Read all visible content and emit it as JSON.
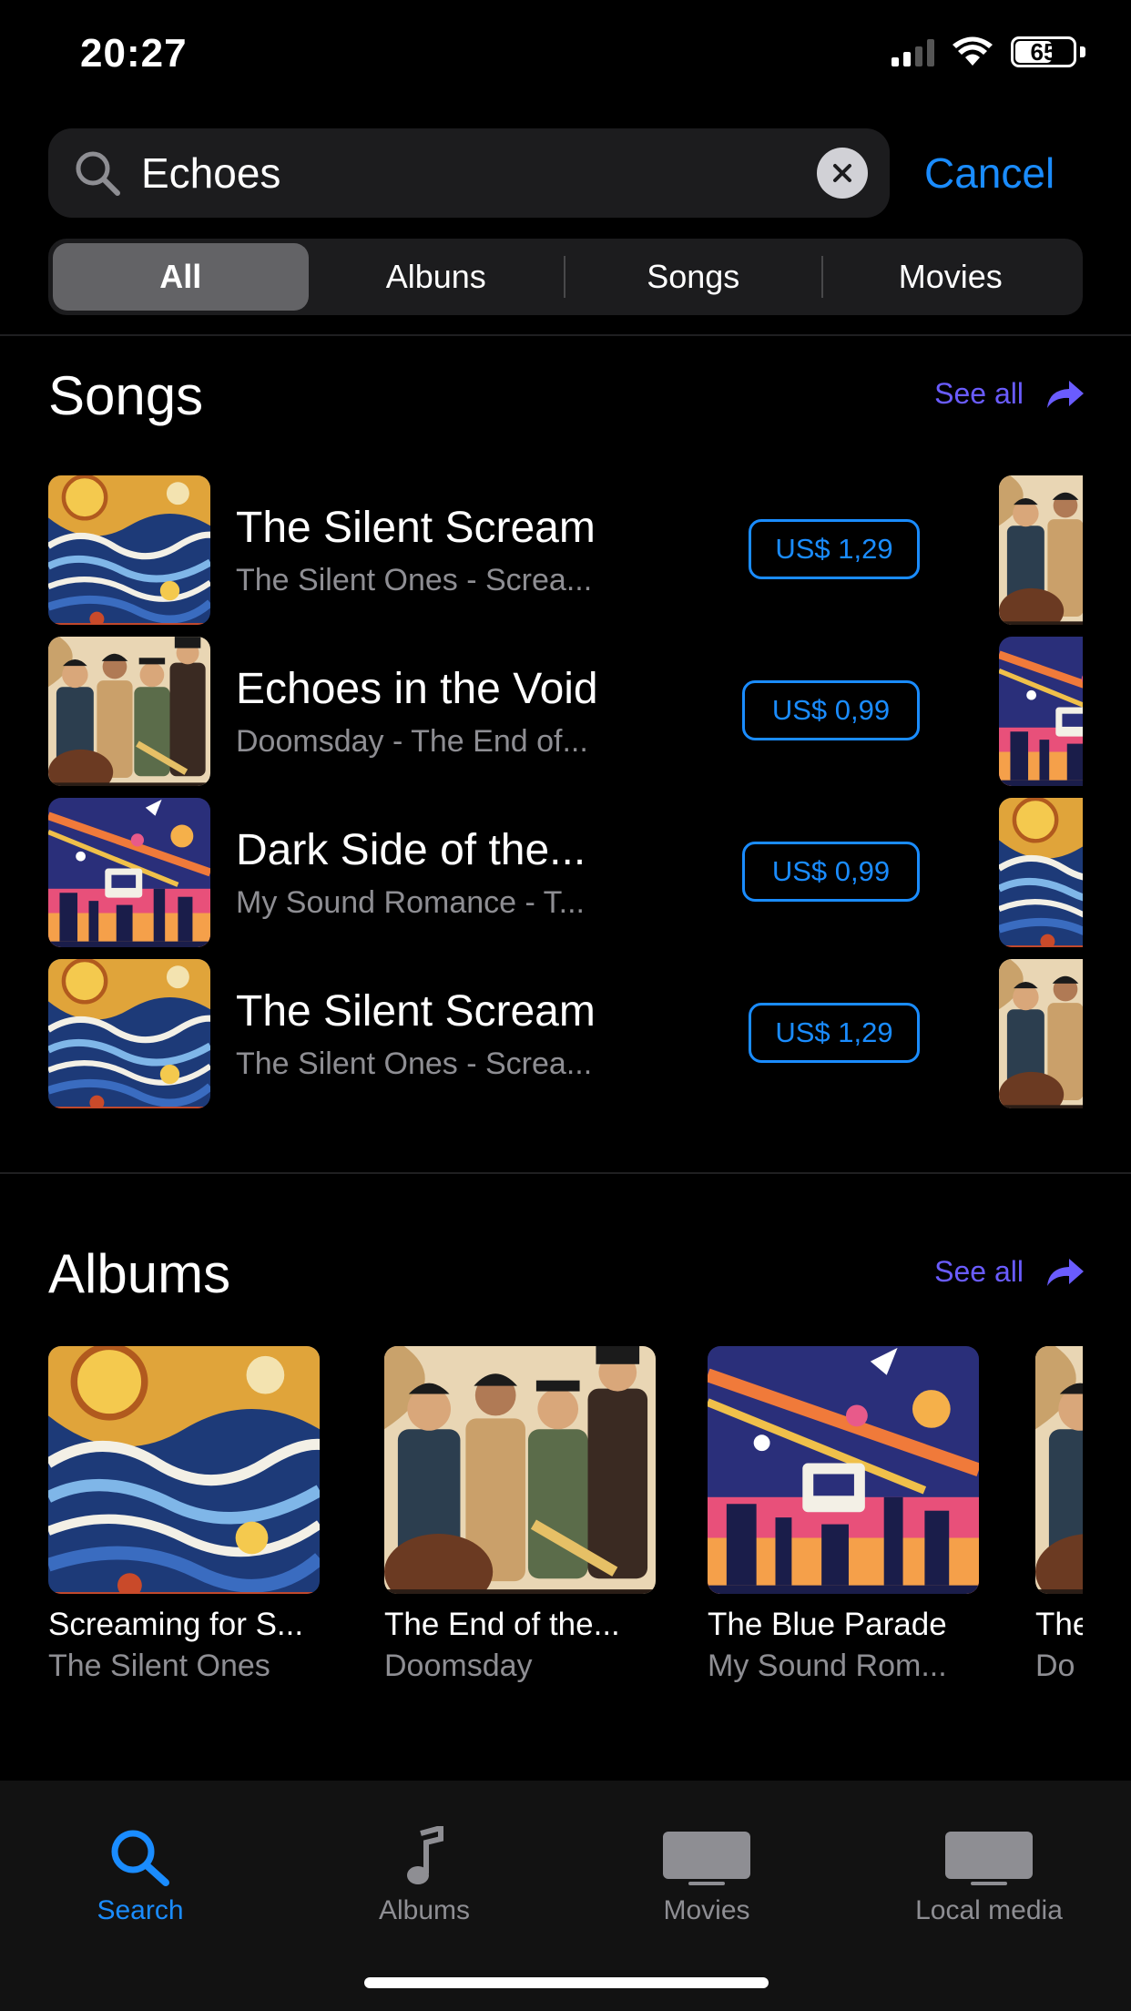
{
  "status_bar": {
    "time": "20:27",
    "battery": "65",
    "battery_level": 0.65
  },
  "search": {
    "query": "Echoes",
    "cancel_label": "Cancel"
  },
  "segments": [
    {
      "label": "All",
      "active": true
    },
    {
      "label": "Albuns",
      "active": false
    },
    {
      "label": "Songs",
      "active": false
    },
    {
      "label": "Movies",
      "active": false
    }
  ],
  "songs_section": {
    "title": "Songs",
    "see_all": "See all",
    "items": [
      {
        "title": "The Silent Scream",
        "subtitle": "The Silent Ones - Screa...",
        "price": "US$ 1,29",
        "art": "swirl"
      },
      {
        "title": "Echoes in the Void",
        "subtitle": "Doomsday - The End of...",
        "price": "US$ 0,99",
        "art": "jazz"
      },
      {
        "title": "Dark Side of the...",
        "subtitle": "My Sound Romance - T...",
        "price": "US$ 0,99",
        "art": "space"
      },
      {
        "title": "The Silent Scream",
        "subtitle": "The Silent Ones - Screa...",
        "price": "US$ 1,29",
        "art": "swirl"
      }
    ]
  },
  "albums_section": {
    "title": "Albums",
    "see_all": "See all",
    "items": [
      {
        "title": "Screaming for S...",
        "artist": "The Silent Ones",
        "art": "swirl"
      },
      {
        "title": "The End of the...",
        "artist": "Doomsday",
        "art": "jazz"
      },
      {
        "title": "The Blue Parade",
        "artist": "My Sound Rom...",
        "art": "space"
      },
      {
        "title": "The",
        "artist": "Do",
        "art": "jazz"
      }
    ]
  },
  "tabbar": {
    "tabs": [
      {
        "label": "Search",
        "icon": "search-icon",
        "active": true
      },
      {
        "label": "Albums",
        "icon": "music-note-icon",
        "active": false
      },
      {
        "label": "Movies",
        "icon": "tv-icon",
        "active": false
      },
      {
        "label": "Local media",
        "icon": "tv-icon",
        "active": false
      }
    ]
  },
  "colors": {
    "accent": "#1a8cff",
    "see_all": "#6a5cff",
    "secondary_text": "#8e8e93",
    "background": "#000000"
  }
}
